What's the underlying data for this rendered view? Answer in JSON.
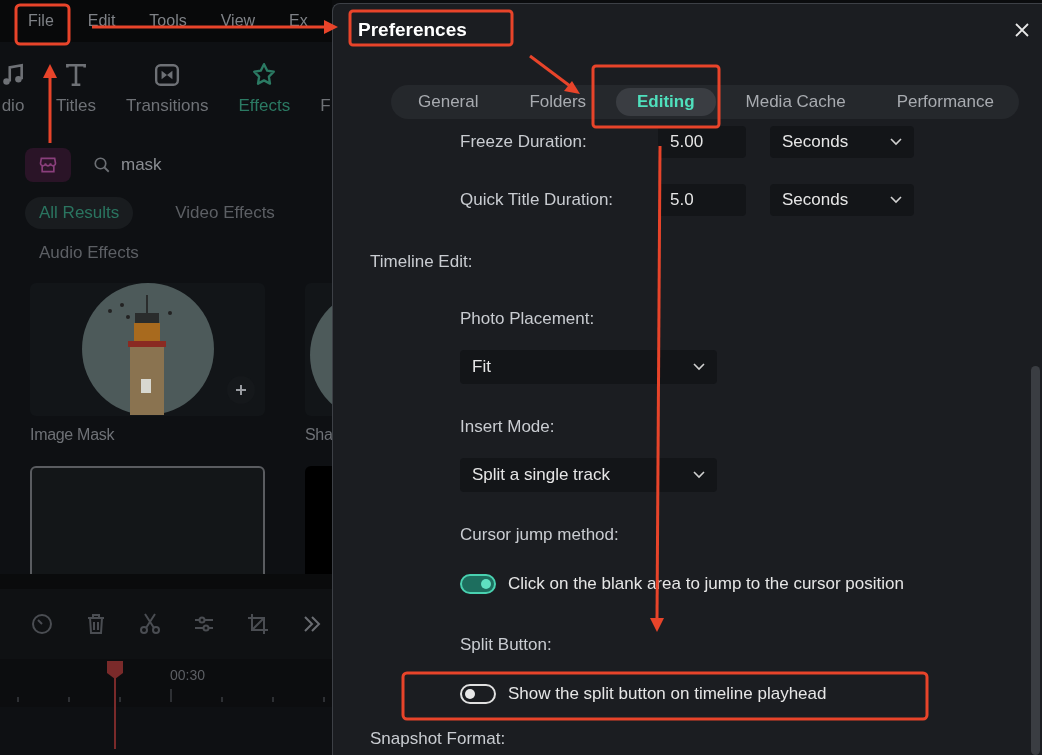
{
  "menu": [
    {
      "label": "File"
    },
    {
      "label": "Edit"
    },
    {
      "label": "Tools"
    },
    {
      "label": "View"
    },
    {
      "label": "Ex"
    }
  ],
  "media_tabs": [
    {
      "label": "dio",
      "selected": false
    },
    {
      "label": "Titles",
      "selected": false
    },
    {
      "label": "Transitions",
      "selected": false
    },
    {
      "label": "Effects",
      "selected": true
    },
    {
      "label": "F",
      "selected": false
    }
  ],
  "search": {
    "value": "mask"
  },
  "filters": [
    {
      "label": "All Results",
      "selected": true
    },
    {
      "label": "Video Effects",
      "selected": false
    },
    {
      "label": "Audio Effects",
      "selected": false
    }
  ],
  "effects": [
    {
      "name": "Image Mask",
      "kind": "picture"
    },
    {
      "name": "Sha",
      "kind": "picture"
    },
    {
      "kind": "outline"
    },
    {
      "kind": "dark"
    }
  ],
  "ruler": {
    "time": "00:30"
  },
  "dialog": {
    "title": "Preferences",
    "tabs": [
      {
        "label": "General",
        "selected": false
      },
      {
        "label": "Folders",
        "selected": false
      },
      {
        "label": "Editing",
        "selected": true
      },
      {
        "label": "Media Cache",
        "selected": false
      },
      {
        "label": "Performance",
        "selected": false
      }
    ],
    "rows": [
      {
        "kind": "duration",
        "label": "Freeze Duration:",
        "value": "5.00",
        "unit": "Seconds"
      },
      {
        "kind": "duration",
        "label": "Quick Title Duration:",
        "value": "5.0",
        "unit": "Seconds"
      },
      {
        "kind": "section",
        "label": "Timeline Edit:"
      },
      {
        "kind": "label",
        "label": "Photo Placement:"
      },
      {
        "kind": "select",
        "value": "Fit"
      },
      {
        "kind": "label",
        "label": "Insert Mode:"
      },
      {
        "kind": "select",
        "value": "Split a single track"
      },
      {
        "kind": "label",
        "label": "Cursor jump method:"
      },
      {
        "kind": "toggle",
        "label": "Click on the blank area to jump to the cursor position",
        "on": true
      },
      {
        "kind": "label",
        "label": "Split Button:"
      },
      {
        "kind": "toggle",
        "label": "Show the split button on timeline playhead",
        "on": false
      },
      {
        "kind": "section",
        "label": "Snapshot Format:"
      }
    ]
  }
}
